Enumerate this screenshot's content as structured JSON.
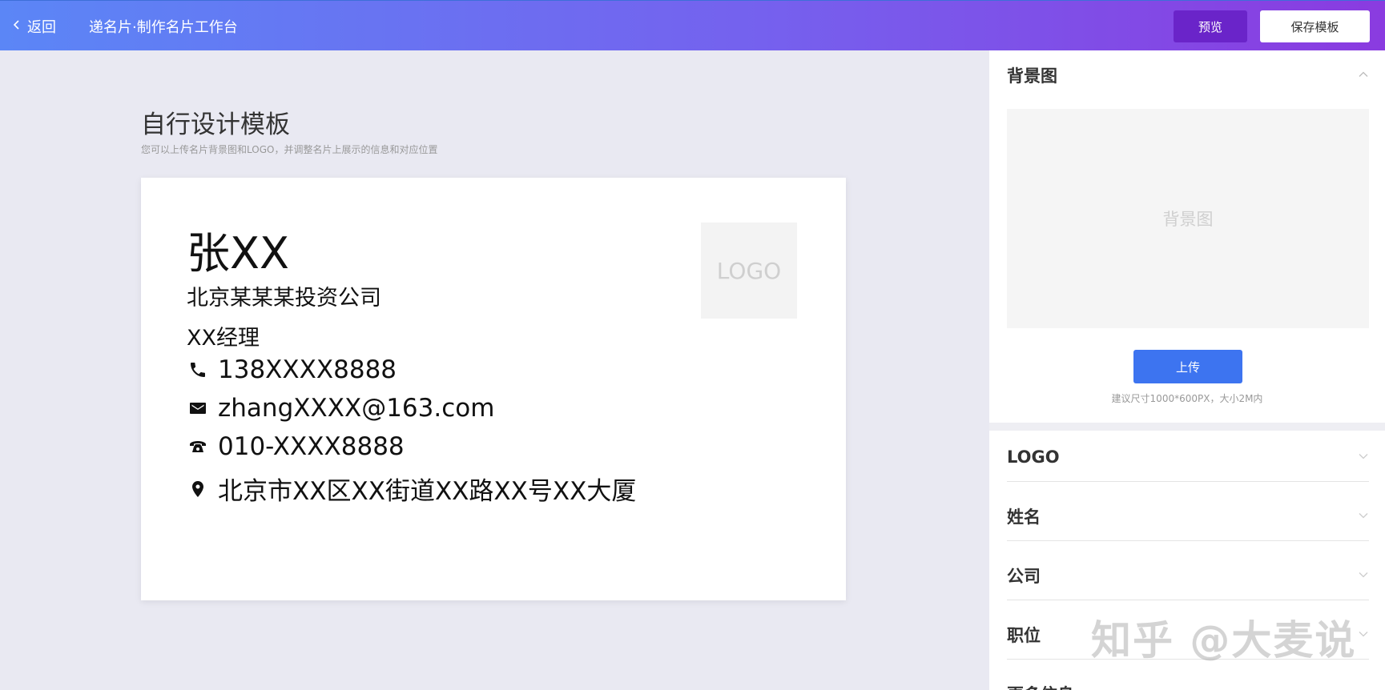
{
  "topbar": {
    "back_label": "返回",
    "breadcrumb": "递名片·制作名片工作台",
    "preview_label": "预览",
    "save_label": "保存模板"
  },
  "main": {
    "title": "自行设计模板",
    "subtitle": "您可以上传名片背景图和LOGO，并调整名片上展示的信息和对应位置"
  },
  "card": {
    "name": "张XX",
    "company": "北京某某某投资公司",
    "position": "XX经理",
    "logo_placeholder": "LOGO",
    "mobile": "138XXXX8888",
    "email": "zhangXXXX@163.com",
    "tel": "010-XXXX8888",
    "address": "北京市XX区XX街道XX路XX号XX大厦"
  },
  "panel": {
    "background": {
      "title": "背景图",
      "placeholder": "背景图",
      "upload_label": "上传",
      "hint": "建议尺寸1000*600PX，大小2M内"
    },
    "sections": [
      {
        "title": "LOGO"
      },
      {
        "title": "姓名"
      },
      {
        "title": "公司"
      },
      {
        "title": "职位"
      },
      {
        "title": "更多信息"
      }
    ]
  },
  "watermark": "知乎 @大麦说",
  "icons": {
    "back": "chevron-left-icon",
    "mobile": "phone-icon",
    "email": "mail-icon",
    "tel": "telephone-icon",
    "address": "location-pin-icon",
    "expanded": "chevron-up-icon",
    "collapsed": "chevron-down-icon"
  }
}
